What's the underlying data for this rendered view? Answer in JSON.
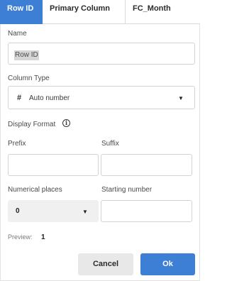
{
  "tabs": [
    {
      "label": "Row ID",
      "active": true
    },
    {
      "label": "Primary Column",
      "active": false
    },
    {
      "label": "FC_Month",
      "active": false
    }
  ],
  "form": {
    "name_label": "Name",
    "name_value": "Row ID",
    "column_type_label": "Column Type",
    "column_type_icon": "#",
    "column_type_value": "Auto number",
    "display_format_label": "Display Format",
    "info_icon_glyph": "i",
    "prefix_label": "Prefix",
    "prefix_value": "",
    "suffix_label": "Suffix",
    "suffix_value": "",
    "numerical_places_label": "Numerical places",
    "numerical_places_value": "0",
    "starting_number_label": "Starting number",
    "starting_number_value": "",
    "preview_label": "Preview:",
    "preview_value": "1"
  },
  "buttons": {
    "cancel": "Cancel",
    "ok": "Ok"
  },
  "colors": {
    "accent": "#3d7fd4",
    "cancel_bg": "#e8e8e8",
    "select_bg": "#f0f0f0"
  }
}
